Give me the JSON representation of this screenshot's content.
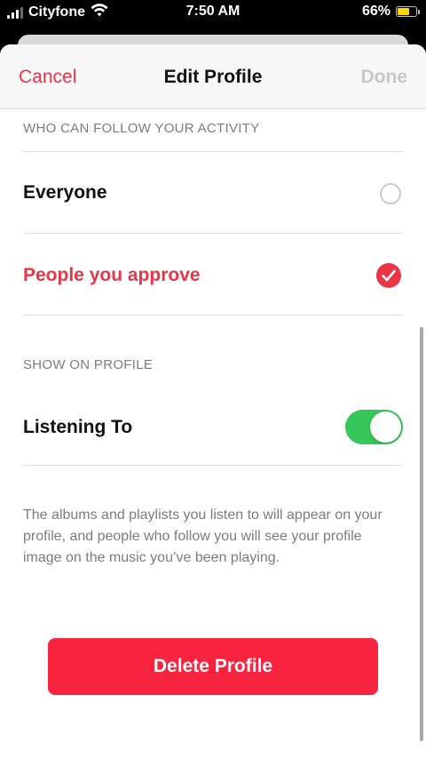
{
  "status_bar": {
    "carrier": "Cityfone",
    "time": "7:50 AM",
    "battery_percent": "66%",
    "battery_level": 0.66,
    "signal_bars": 3,
    "signal_total": 4,
    "wifi_icon": "wifi-icon",
    "battery_color": "#ffd60a"
  },
  "nav": {
    "cancel_label": "Cancel",
    "title": "Edit Profile",
    "done_label": "Done"
  },
  "follow_section": {
    "header": "WHO CAN FOLLOW YOUR ACTIVITY",
    "options": [
      {
        "label": "Everyone",
        "selected": false
      },
      {
        "label": "People you approve",
        "selected": true
      }
    ]
  },
  "profile_section": {
    "header": "SHOW ON PROFILE",
    "listening_to_label": "Listening To",
    "listening_to_enabled": true,
    "footer_text": "The albums and playlists you listen to will appear on your profile, and people who follow you will see your profile image on the music you’ve been playing."
  },
  "delete_button_label": "Delete Profile",
  "colors": {
    "accent": "#ea3546",
    "toggle_on": "#35c759",
    "delete": "#f8243f"
  }
}
